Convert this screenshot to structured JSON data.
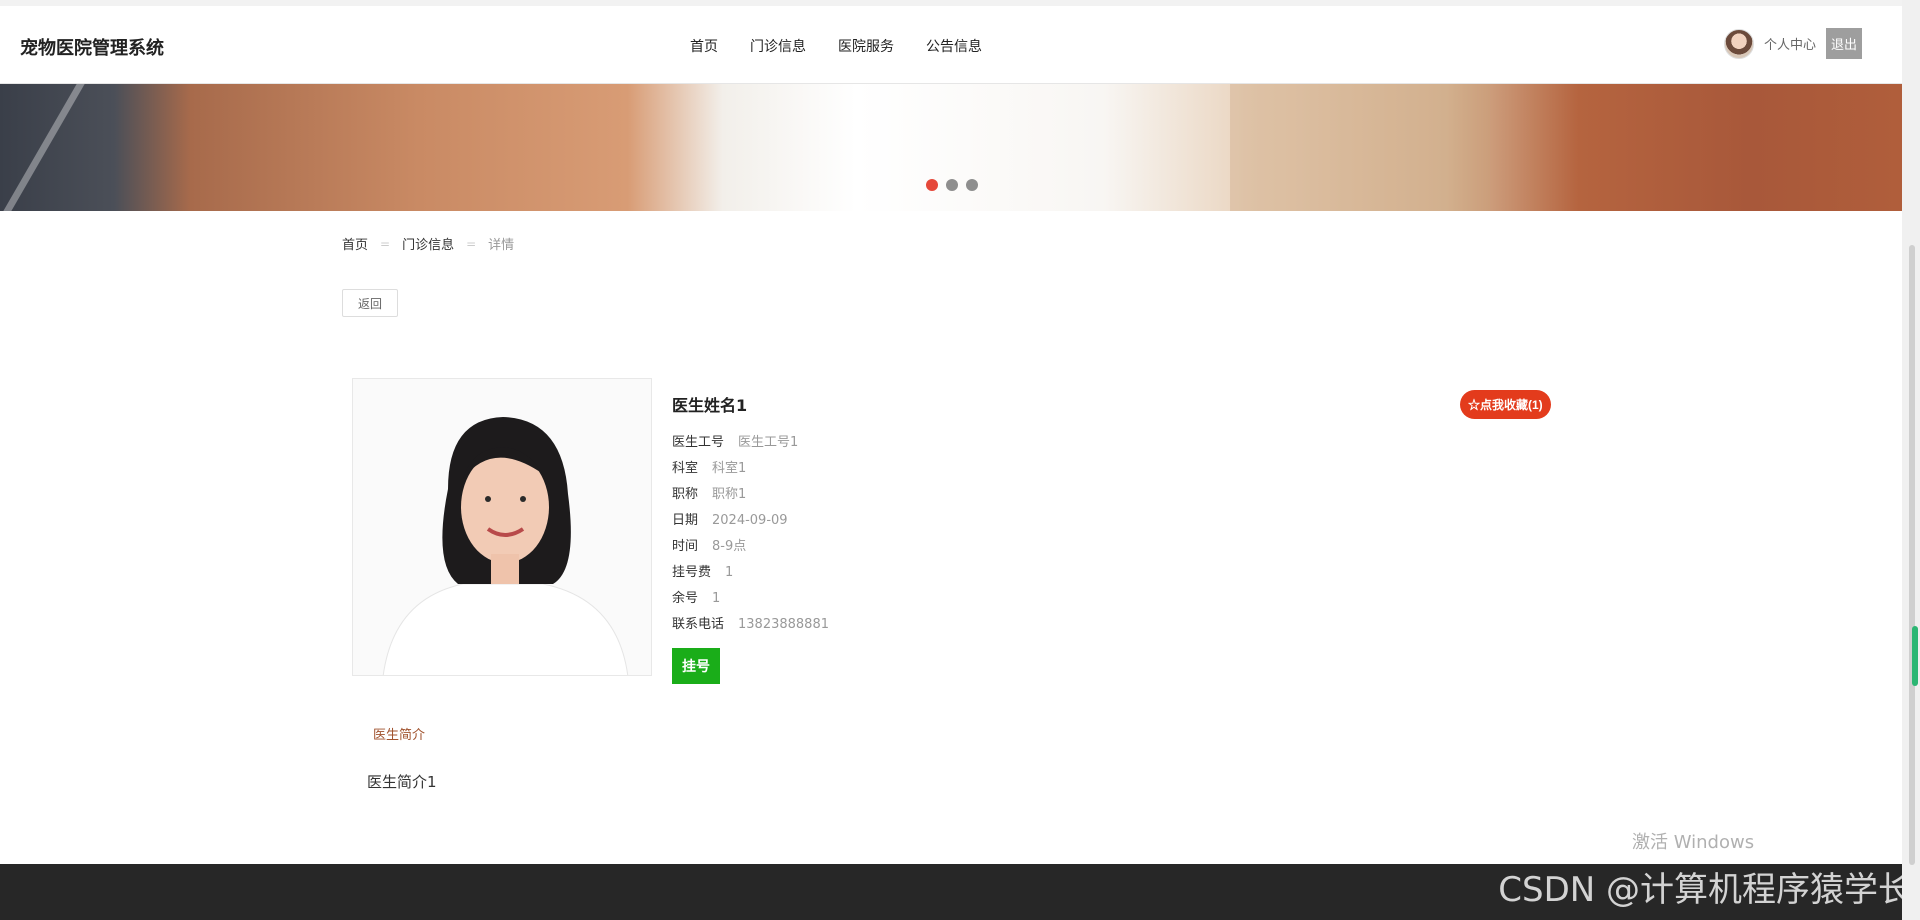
{
  "header": {
    "brand": "宠物医院管理系统",
    "nav": [
      "首页",
      "门诊信息",
      "医院服务",
      "公告信息"
    ],
    "user_center": "个人中心",
    "logout": "退出"
  },
  "banner": {
    "slide_count": 3,
    "active_slide": 1
  },
  "breadcrumb": {
    "home": "首页",
    "section": "门诊信息",
    "current": "详情"
  },
  "back_label": "返回",
  "doctor": {
    "name": "医生姓名1",
    "favorite_label": "☆点我收藏(1)",
    "fields": [
      {
        "label": "医生工号",
        "value": "医生工号1"
      },
      {
        "label": "科室",
        "value": "科室1"
      },
      {
        "label": "职称",
        "value": "职称1"
      },
      {
        "label": "日期",
        "value": "2024-09-09"
      },
      {
        "label": "时间",
        "value": "8-9点"
      },
      {
        "label": "挂号费",
        "value": "1"
      },
      {
        "label": "余号",
        "value": "1"
      },
      {
        "label": "联系电话",
        "value": "13823888881"
      }
    ],
    "register_label": "挂号",
    "intro_tab": "医生简介",
    "intro_text": "医生简介1"
  },
  "overlay": {
    "windows_activate": "激活 Windows",
    "watermark": "CSDN @计算机程序猿学长"
  },
  "colors": {
    "accent_red": "#e33b1c",
    "register_green": "#1aad19",
    "footer": "#272727"
  }
}
